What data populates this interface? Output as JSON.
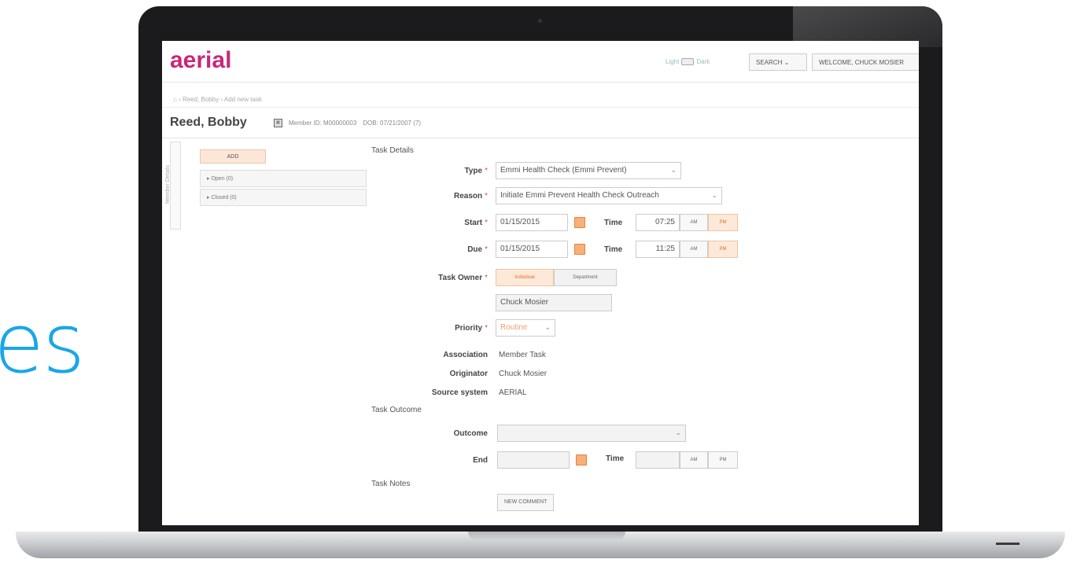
{
  "background_text": "es",
  "app": {
    "logo": "aerial",
    "theme_light": "Light",
    "theme_dark": "Dark",
    "search_label": "SEARCH",
    "welcome_label": "WELCOME, CHUCK MOSIER",
    "breadcrumb": "⌂ › Reed, Bobby › Add new task"
  },
  "patient": {
    "name": "Reed, Bobby",
    "member_id": "Member ID: M00000003",
    "dob": "DOB: 07/21/2007 (7)"
  },
  "left": {
    "side_tab": "Member Details",
    "add_label": "ADD",
    "panels": [
      "Open (0)",
      "Closed (0)"
    ]
  },
  "task_details": {
    "section_title": "Task Details",
    "type_label": "Type",
    "type_value": "Emmi Health Check (Emmi Prevent)",
    "reason_label": "Reason",
    "reason_value": "Initiate Emmi Prevent Health Check Outreach",
    "start_label": "Start",
    "start_date": "01/15/2015",
    "start_time": "07:25",
    "due_label": "Due",
    "due_date": "01/15/2015",
    "due_time": "11:25",
    "time_label": "Time",
    "am": "AM",
    "pm": "PM",
    "owner_label": "Task Owner",
    "owner_individual": "Individual",
    "owner_department": "Department",
    "owner_value": "Chuck Mosier",
    "priority_label": "Priority",
    "priority_value": "Routine",
    "association_label": "Association",
    "association_value": "Member Task",
    "originator_label": "Originator",
    "originator_value": "Chuck Mosier",
    "source_label": "Source system",
    "source_value": "AERIAL"
  },
  "task_outcome": {
    "section_title": "Task Outcome",
    "outcome_label": "Outcome",
    "outcome_value": "",
    "end_label": "End",
    "end_date": "",
    "end_time": ""
  },
  "task_notes": {
    "section_title": "Task Notes",
    "new_comment_label": "NEW COMMENT"
  },
  "colors": {
    "brand": "#c7287b",
    "accent": "#f8b07a",
    "background_text": "#1aa6e8",
    "required": "#e04c4c"
  }
}
